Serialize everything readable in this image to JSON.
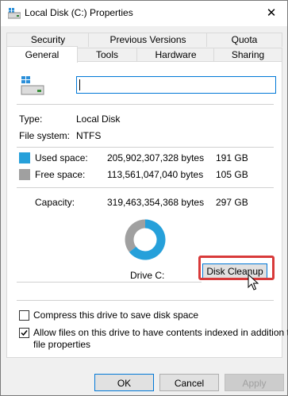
{
  "window": {
    "title": "Local Disk (C:) Properties",
    "close_glyph": "✕"
  },
  "tabs_row1": [
    {
      "label": "Security"
    },
    {
      "label": "Previous Versions"
    },
    {
      "label": "Quota"
    }
  ],
  "tabs_row2": [
    {
      "label": "General",
      "active": true
    },
    {
      "label": "Tools"
    },
    {
      "label": "Hardware"
    },
    {
      "label": "Sharing"
    }
  ],
  "general": {
    "drive_name_value": "",
    "type_label": "Type:",
    "type_value": "Local Disk",
    "fs_label": "File system:",
    "fs_value": "NTFS",
    "used": {
      "label": "Used space:",
      "bytes": "205,902,307,328 bytes",
      "size": "191 GB",
      "color": "#26a0da"
    },
    "free": {
      "label": "Free space:",
      "bytes": "113,561,047,040 bytes",
      "size": "105 GB",
      "color": "#a0a0a0"
    },
    "capacity": {
      "label": "Capacity:",
      "bytes": "319,463,354,368 bytes",
      "size": "297 GB"
    },
    "drive_label": "Drive C:",
    "cleanup_button": "Disk Cleanup",
    "used_fraction": 0.6445,
    "compress": {
      "label": "Compress this drive to save disk space",
      "checked": false
    },
    "index": {
      "label_line1": "Allow files on this drive to have contents indexed in addition to",
      "label_line2": "file properties",
      "checked": true
    }
  },
  "buttons": {
    "ok": "OK",
    "cancel": "Cancel",
    "apply": "Apply"
  }
}
